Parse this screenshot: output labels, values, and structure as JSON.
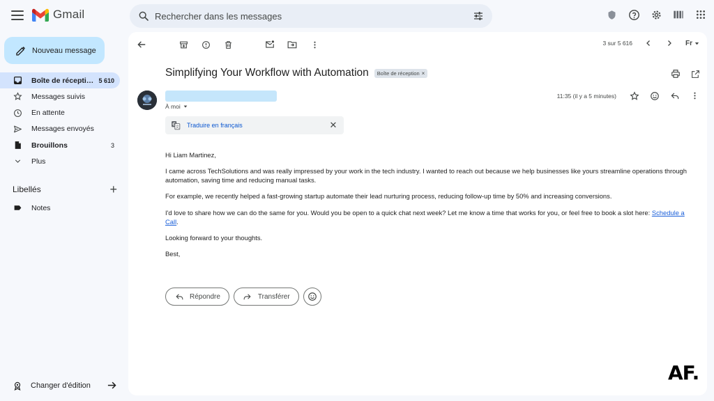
{
  "header": {
    "app_name": "Gmail",
    "search_placeholder": "Rechercher dans les messages"
  },
  "sidebar": {
    "compose_label": "Nouveau message",
    "items": [
      {
        "label": "Boîte de récepti…",
        "count": "5 610",
        "icon": "inbox-icon",
        "active": true
      },
      {
        "label": "Messages suivis",
        "count": "",
        "icon": "star-icon"
      },
      {
        "label": "En attente",
        "count": "",
        "icon": "clock-icon"
      },
      {
        "label": "Messages envoyés",
        "count": "",
        "icon": "send-icon"
      },
      {
        "label": "Brouillons",
        "count": "3",
        "icon": "draft-icon"
      },
      {
        "label": "Plus",
        "count": "",
        "icon": "chevron-down-icon"
      }
    ],
    "labels_title": "Libellés",
    "labels_add": "+",
    "notes_label": "Notes",
    "edit_mode_label": "Changer d'édition"
  },
  "toolbar": {
    "pager_text": "3 sur 5 616",
    "lang_label": "Fr"
  },
  "message": {
    "subject": "Simplifying Your Workflow with Automation",
    "label_chip": "Boîte de réception",
    "label_chip_close": "×",
    "to_me": "À moi",
    "time": "11:35 (il y a 5 minutes)",
    "translate_link": "Traduire en français",
    "translate_close": "✕",
    "greeting": "Hi Liam Martinez,",
    "para1": "I came across TechSolutions and was really impressed by your work in the tech industry. I wanted to reach out because we help businesses like yours streamline operations through automation, saving time and reducing manual tasks.",
    "para2": "For example, we recently helped a fast-growing startup automate their lead nurturing process, reducing follow-up time by 50% and increasing conversions.",
    "para3_text": "I'd love to share how we can do the same for you. Would you be open to a quick chat next week? Let me know a time that works for you, or feel free to book a slot here: ",
    "para3_link": "Schedule a Call",
    "para3_end": ".",
    "closing1": "Looking forward to your thoughts.",
    "closing2": "Best,"
  },
  "actions": {
    "reply_label": "Répondre",
    "forward_label": "Transférer"
  },
  "watermark": "AF.",
  "colors": {
    "accent_blue": "#0b57d0",
    "compose_bg": "#c2e7ff",
    "active_nav_bg": "#d3e3fd",
    "page_bg": "#f6f8fc"
  }
}
